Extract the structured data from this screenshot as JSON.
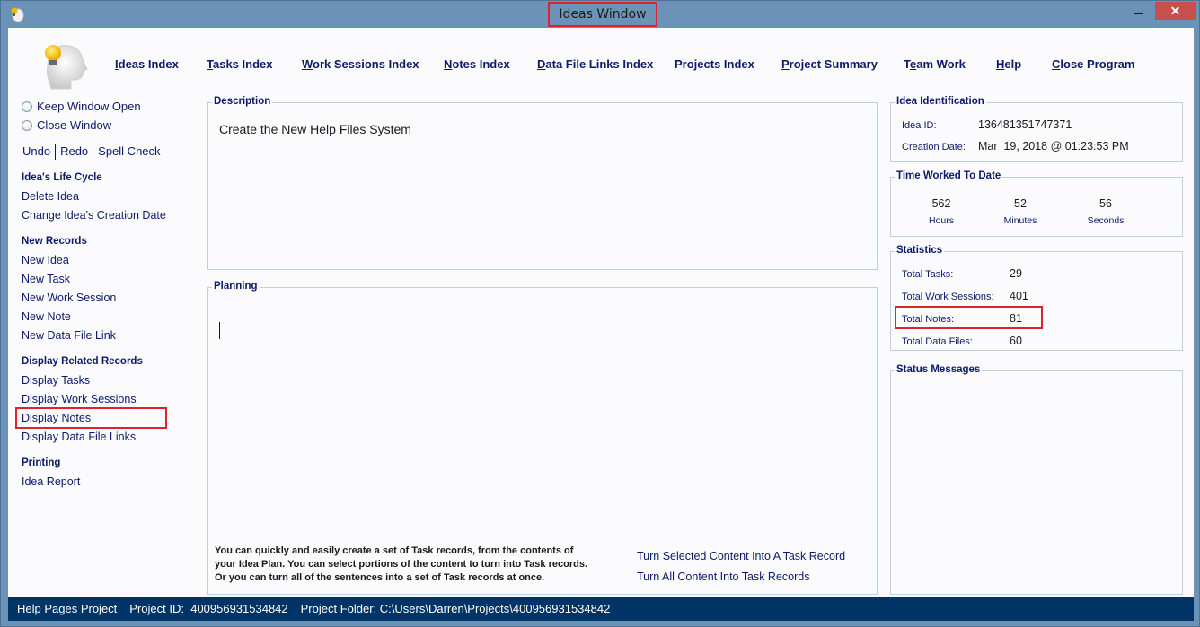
{
  "window": {
    "title": "Ideas Window",
    "close_glyph": "✕"
  },
  "topnav": [
    {
      "label": "Ideas Index",
      "accesskey": "I"
    },
    {
      "label": "Tasks Index",
      "accesskey": "T"
    },
    {
      "label": "Work Sessions Index",
      "accesskey": "W"
    },
    {
      "label": "Notes Index",
      "accesskey": "N"
    },
    {
      "label": "Data File Links Index",
      "accesskey": "D"
    },
    {
      "label": "Projects Index",
      "accesskey": ""
    },
    {
      "label": "Project Summary",
      "accesskey": "P"
    },
    {
      "label": "Team Work",
      "accesskey": "e"
    },
    {
      "label": "Help",
      "accesskey": "H"
    },
    {
      "label": "Close Program",
      "accesskey": "C"
    }
  ],
  "sidebar": {
    "radios": [
      {
        "label": "Keep Window Open",
        "selected": false
      },
      {
        "label": "Close Window",
        "selected": false
      }
    ],
    "edit": {
      "undo": "Undo",
      "redo": "Redo",
      "spell": "Spell Check"
    },
    "sections": [
      {
        "heading": "Idea's Life Cycle",
        "items": [
          "Delete Idea",
          "Change Idea's Creation Date"
        ]
      },
      {
        "heading": "New Records",
        "items": [
          "New Idea",
          "New Task",
          "New Work Session",
          "New Note",
          "New Data File Link"
        ]
      },
      {
        "heading": "Display Related Records",
        "items": [
          "Display Tasks",
          "Display Work Sessions",
          "Display Notes",
          "Display Data File Links"
        ]
      },
      {
        "heading": "Printing",
        "items": [
          "Idea Report"
        ]
      }
    ]
  },
  "description": {
    "label": "Description",
    "text": "Create the New Help Files System"
  },
  "planning": {
    "label": "Planning",
    "text": "",
    "hint_lines": [
      "You can quickly and easily create a set of Task records, from the contents of",
      "your Idea Plan. You can select portions of the content to turn into Task records.",
      "Or you can turn all of the sentences into a set of Task records at once."
    ],
    "links": [
      "Turn Selected Content Into A Task Record",
      "Turn All Content Into Task Records"
    ]
  },
  "identification": {
    "label": "Idea Identification",
    "id_label": "Idea ID:",
    "id_value": "136481351747371",
    "date_label": "Creation Date:",
    "date_value": "Mar  19, 2018 @ 01:23:53 PM"
  },
  "time_worked": {
    "label": "Time Worked To Date",
    "hours": "562",
    "hours_label": "Hours",
    "minutes": "52",
    "minutes_label": "Minutes",
    "seconds": "56",
    "seconds_label": "Seconds"
  },
  "statistics": {
    "label": "Statistics",
    "rows": [
      {
        "label": "Total Tasks:",
        "value": "29"
      },
      {
        "label": "Total Work Sessions:",
        "value": "401"
      },
      {
        "label": "Total Notes:",
        "value": "81"
      },
      {
        "label": "Total Data Files:",
        "value": "60"
      }
    ]
  },
  "status_messages": {
    "label": "Status Messages",
    "text": ""
  },
  "statusbar": {
    "project_name": "Help Pages Project",
    "project_id": "Project ID:  400956931534842",
    "project_folder": "Project Folder: C:\\Users\\Darren\\Projects\\400956931534842"
  },
  "colors": {
    "frame": "#6b93b7",
    "statusbar": "#003366",
    "link_text": "#0b1a6b",
    "highlight": "#e0222a",
    "close_button": "#c7504f"
  }
}
